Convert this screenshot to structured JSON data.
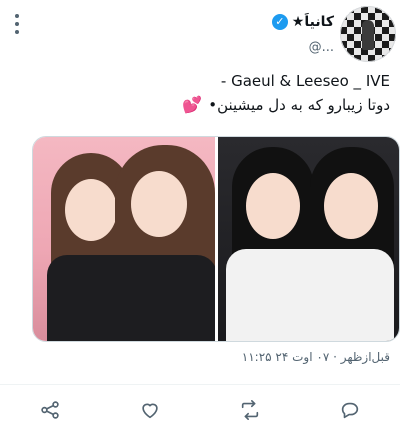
{
  "tweet": {
    "display_name": "★کانیاَ",
    "verified_mark": "✓",
    "handle": "@...",
    "text_line1": "- Gaeul & Leeseo _ IVE",
    "text_line2": "•دوتا زیبارو که به دل میشینن",
    "emoji": "💕",
    "timestamp": "۱۱:۲۵ قبل‌ازظهر · ۰۷ اوت ۲۴"
  },
  "icons": {
    "more": "more-vertical-icon",
    "share": "share-icon",
    "like": "heart-icon",
    "retweet": "retweet-icon",
    "reply": "reply-icon"
  },
  "colors": {
    "verified": "#1d9bf0",
    "secondary_text": "#536471",
    "emoji_pink": "#ff4fa0"
  }
}
